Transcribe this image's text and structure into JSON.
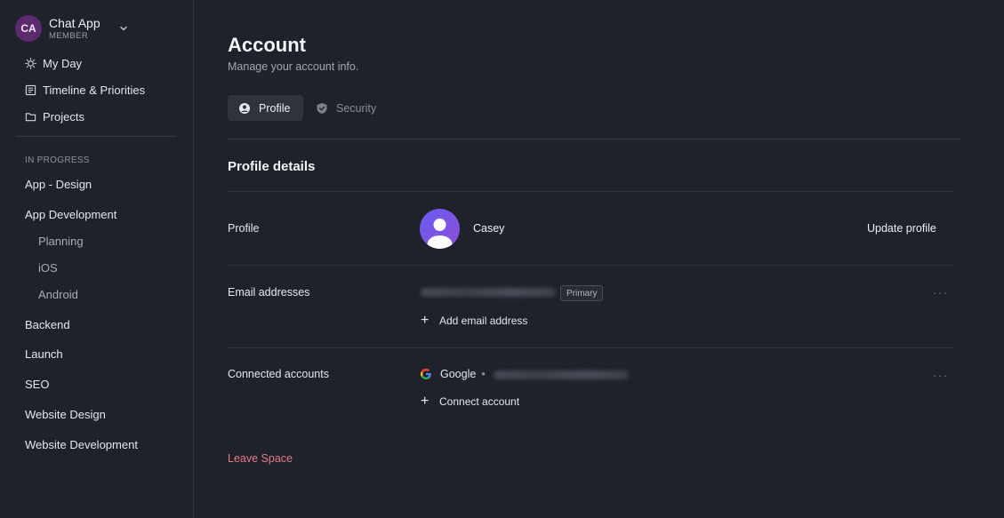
{
  "workspace": {
    "initials": "CA",
    "name": "Chat App",
    "role": "MEMBER"
  },
  "sidebar": {
    "nav": [
      {
        "label": "My Day",
        "icon": "sun-icon"
      },
      {
        "label": "Timeline & Priorities",
        "icon": "timeline-icon"
      },
      {
        "label": "Projects",
        "icon": "folder-icon"
      }
    ],
    "section_label": "IN PROGRESS",
    "projects": [
      {
        "label": "App - Design"
      },
      {
        "label": "App Development"
      },
      {
        "label": "Planning"
      },
      {
        "label": "iOS"
      },
      {
        "label": "Android"
      },
      {
        "label": "Backend"
      },
      {
        "label": "Launch"
      },
      {
        "label": "SEO"
      },
      {
        "label": "Website Design"
      },
      {
        "label": "Website Development"
      }
    ]
  },
  "main": {
    "title": "Account",
    "subtitle": "Manage your account info.",
    "tabs": [
      {
        "label": "Profile",
        "icon": "user-circle-icon",
        "active": true
      },
      {
        "label": "Security",
        "icon": "shield-icon",
        "active": false
      }
    ],
    "section_title": "Profile details",
    "profile": {
      "label": "Profile",
      "name": "Casey",
      "update_label": "Update profile"
    },
    "email": {
      "label": "Email addresses",
      "badge": "Primary",
      "add_label": "Add email address"
    },
    "connected": {
      "label": "Connected accounts",
      "provider": "Google",
      "connect_label": "Connect account"
    },
    "leave_label": "Leave Space",
    "more_label": "···"
  },
  "colors": {
    "background": "#20222b",
    "danger": "#e57b87",
    "avatar_gradient_start": "#6b5cf0",
    "workspace_avatar": "#5b2b6e"
  }
}
